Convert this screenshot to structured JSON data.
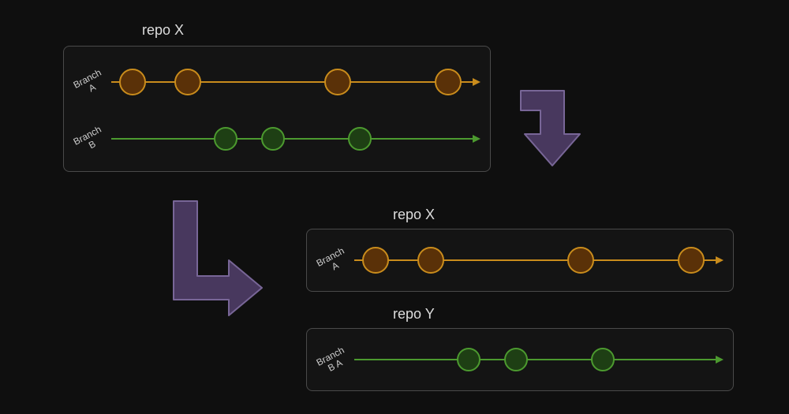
{
  "diagram": {
    "top_repo": {
      "title": "repo X",
      "branch_a_label": "Branch\nA",
      "branch_b_label": "Branch\nB"
    },
    "right_repo_x": {
      "title": "repo X",
      "branch_a_label": "Branch\nA"
    },
    "right_repo_y": {
      "title": "repo Y",
      "branch_a_label": "Branch\nB A"
    },
    "colors": {
      "orange_fill": "#5a3108",
      "orange_stroke": "#c98c1c",
      "green_fill": "#1e3f14",
      "green_stroke": "#4c9a2f",
      "arrow_fill": "#48385e",
      "arrow_stroke": "#786697"
    }
  }
}
